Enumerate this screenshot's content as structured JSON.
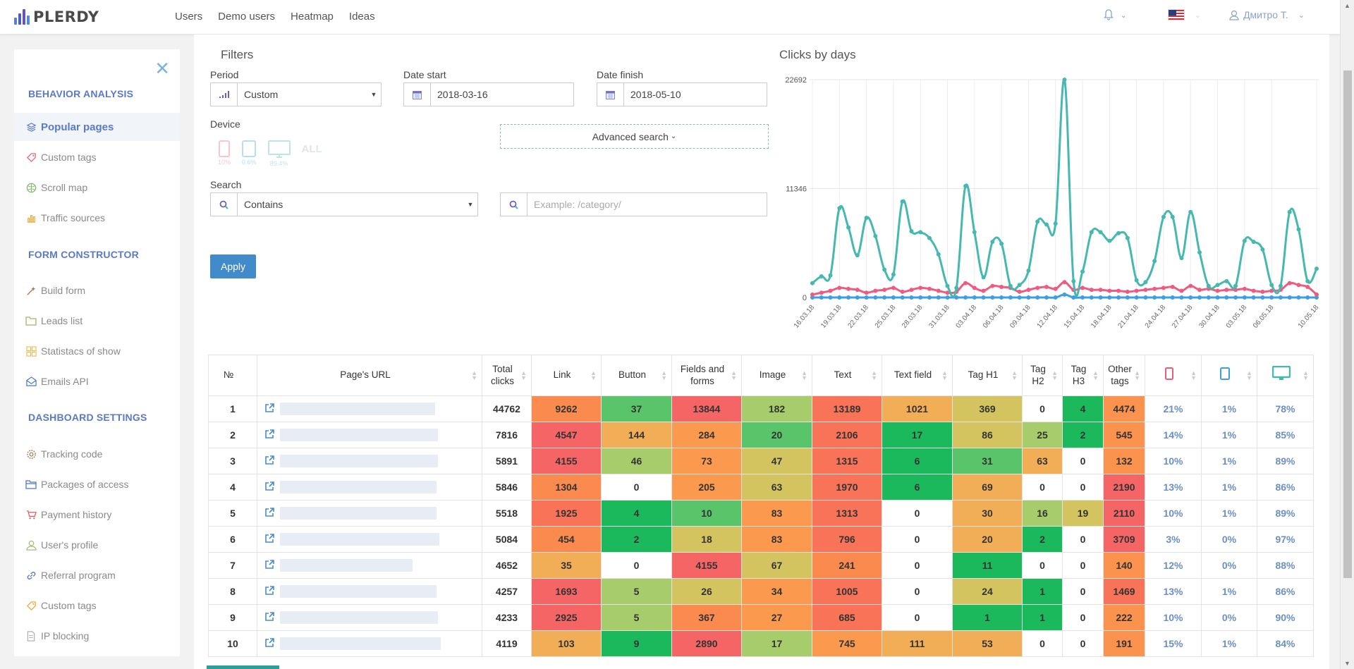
{
  "header": {
    "logo_text": "PLERDY",
    "nav": [
      "Users",
      "Demo users",
      "Heatmap",
      "Ideas"
    ],
    "user_name": "Дмитро Т.",
    "icons": {
      "notifications": "bell-icon",
      "language": "us-flag-icon",
      "user": "user-icon"
    }
  },
  "sidebar": {
    "sections": [
      {
        "heading": "BEHAVIOR ANALYSIS",
        "items": [
          {
            "label": "Popular pages",
            "icon": "layers-icon",
            "active": true
          },
          {
            "label": "Custom tags",
            "icon": "tag-icon"
          },
          {
            "label": "Scroll map",
            "icon": "scroll-icon"
          },
          {
            "label": "Traffic sources",
            "icon": "bar-chart-icon"
          }
        ]
      },
      {
        "heading": "FORM CONSTRUCTOR",
        "items": [
          {
            "label": "Build form",
            "icon": "wand-icon"
          },
          {
            "label": "Leads list",
            "icon": "folder-icon"
          },
          {
            "label": "Statistacs of show",
            "icon": "grid-icon"
          },
          {
            "label": "Emails API",
            "icon": "envelope-icon"
          }
        ]
      },
      {
        "heading": "DASHBOARD SETTINGS",
        "items": [
          {
            "label": "Tracking code",
            "icon": "gear-icon"
          },
          {
            "label": "Packages of access",
            "icon": "folder-open-icon"
          },
          {
            "label": "Payment history",
            "icon": "cart-icon"
          },
          {
            "label": "User's profile",
            "icon": "user-icon"
          },
          {
            "label": "Referral program",
            "icon": "link-icon"
          },
          {
            "label": "Custom tags",
            "icon": "tag-icon"
          },
          {
            "label": "IP blocking",
            "icon": "document-icon"
          }
        ]
      }
    ]
  },
  "filters": {
    "title": "Filters",
    "period_label": "Period",
    "period_value": "Custom",
    "date_start_label": "Date start",
    "date_start_value": "2018-03-16",
    "date_finish_label": "Date finish",
    "date_finish_value": "2018-05-10",
    "device_label": "Device",
    "devices": [
      {
        "name": "mobile",
        "pct": "10%"
      },
      {
        "name": "tablet",
        "pct": "0.6%"
      },
      {
        "name": "desktop",
        "pct": "89.4%"
      }
    ],
    "device_all": "ALL",
    "advanced_search_label": "Advanced search",
    "search_label": "Search",
    "search_mode": "Contains",
    "search_placeholder": "Example: /category/",
    "apply_label": "Apply"
  },
  "colors": {
    "accent": "#428bca",
    "heading": "#5b79c9",
    "desktop_series": "#45b8b0",
    "mobile_series": "#ef5b7e",
    "tablet_series": "#3d9fe0"
  },
  "chart_data": {
    "type": "line",
    "title": "Clicks by days",
    "xlabel": "",
    "ylabel": "",
    "ylim": [
      0,
      22692
    ],
    "yticks": [
      0,
      11346,
      22692
    ],
    "grid": true,
    "x_tick_labels": [
      "16.03.18",
      "19.03.18",
      "22.03.18",
      "25.03.18",
      "28.03.18",
      "31.03.18",
      "03.04.18",
      "06.04.18",
      "09.04.18",
      "12.04.18",
      "15.04.18",
      "18.04.18",
      "21.04.18",
      "24.04.18",
      "27.04.18",
      "30.04.18",
      "03.05.18",
      "06.05.18",
      "10.05.18"
    ],
    "series": [
      {
        "name": "Desktop",
        "values": [
          1500,
          2200,
          2300,
          9300,
          7300,
          4400,
          8300,
          6400,
          2900,
          2400,
          10000,
          6900,
          6800,
          6200,
          4500,
          1200,
          1000,
          11600,
          6800,
          2100,
          5800,
          5600,
          1200,
          1300,
          2800,
          7900,
          7600,
          7700,
          22692,
          1700,
          2700,
          6800,
          6800,
          5900,
          6700,
          6200,
          1800,
          1600,
          3800,
          8400,
          8400,
          4100,
          8900,
          4700,
          1200,
          1300,
          1700,
          1200,
          5900,
          5800,
          5000,
          1300,
          1200,
          8900,
          7100,
          1700,
          3000
        ]
      },
      {
        "name": "Mobile",
        "values": [
          300,
          500,
          700,
          1000,
          900,
          800,
          500,
          700,
          800,
          1000,
          600,
          800,
          1000,
          900,
          700,
          500,
          600,
          1500,
          1000,
          700,
          1200,
          1100,
          1000,
          600,
          800,
          1000,
          1100,
          900,
          1600,
          800,
          1000,
          800,
          800,
          700,
          700,
          600,
          700,
          800,
          900,
          1000,
          1100,
          700,
          1200,
          800,
          900,
          700,
          800,
          800,
          900,
          700,
          600,
          700,
          800,
          1500,
          1300,
          1100,
          300
        ]
      },
      {
        "name": "Tablet",
        "values": [
          0,
          0,
          0,
          0,
          0,
          0,
          0,
          0,
          0,
          0,
          0,
          0,
          0,
          0,
          0,
          0,
          0,
          0,
          0,
          0,
          0,
          0,
          0,
          0,
          0,
          0,
          0,
          0,
          300,
          0,
          0,
          0,
          0,
          0,
          0,
          0,
          0,
          0,
          0,
          0,
          0,
          0,
          0,
          0,
          0,
          0,
          0,
          0,
          0,
          0,
          0,
          0,
          0,
          0,
          0,
          0,
          0
        ]
      }
    ],
    "legend": "none"
  },
  "table": {
    "columns": [
      "№",
      "Page's URL",
      "Total clicks",
      "Link",
      "Button",
      "Fields and forms",
      "Image",
      "Text",
      "Text field",
      "Tag H1",
      "Tag H2",
      "Tag H3",
      "Other tags",
      "mobile-icon",
      "tablet-icon",
      "desktop-icon"
    ],
    "rows": [
      {
        "n": "1",
        "total": "44762",
        "cells": [
          "9262",
          "37",
          "13844",
          "182",
          "13189",
          "1021",
          "369",
          "0",
          "4",
          "4474"
        ],
        "colors": [
          "#fb8a4f",
          "#5ac46b",
          "#f56565",
          "#a7cc6b",
          "#f87358",
          "#f2ae57",
          "#d4c45f",
          "#ffffff",
          "#1cb85c",
          "#fb924e"
        ],
        "mobile": "21%",
        "tablet": "1%",
        "desktop": "78%"
      },
      {
        "n": "2",
        "total": "7816",
        "cells": [
          "4547",
          "144",
          "284",
          "20",
          "2106",
          "17",
          "86",
          "25",
          "2",
          "545"
        ],
        "colors": [
          "#f56565",
          "#f2ae57",
          "#fb9a4e",
          "#5ac46b",
          "#f87358",
          "#1cb85c",
          "#d4c45f",
          "#a7cc6b",
          "#1cb85c",
          "#fb924e"
        ],
        "mobile": "14%",
        "tablet": "1%",
        "desktop": "85%"
      },
      {
        "n": "3",
        "total": "5891",
        "cells": [
          "4155",
          "46",
          "73",
          "47",
          "1315",
          "6",
          "31",
          "63",
          "0",
          "132"
        ],
        "colors": [
          "#f56565",
          "#a7cc6b",
          "#fb9a4e",
          "#d4c45f",
          "#f87358",
          "#1cb85c",
          "#5ac46b",
          "#f2ae57",
          "#ffffff",
          "#fb924e"
        ],
        "mobile": "10%",
        "tablet": "1%",
        "desktop": "89%"
      },
      {
        "n": "4",
        "total": "5846",
        "cells": [
          "1304",
          "0",
          "205",
          "63",
          "1970",
          "6",
          "69",
          "0",
          "0",
          "2190"
        ],
        "colors": [
          "#fb8a4f",
          "#ffffff",
          "#fb9a4e",
          "#d4c45f",
          "#f87358",
          "#1cb85c",
          "#f2ae57",
          "#ffffff",
          "#ffffff",
          "#f56565"
        ],
        "mobile": "13%",
        "tablet": "1%",
        "desktop": "86%"
      },
      {
        "n": "5",
        "total": "5518",
        "cells": [
          "1925",
          "4",
          "10",
          "83",
          "1313",
          "0",
          "30",
          "16",
          "19",
          "2110"
        ],
        "colors": [
          "#f87358",
          "#1cb85c",
          "#5ac46b",
          "#fb9a4e",
          "#f87358",
          "#ffffff",
          "#f2ae57",
          "#a7cc6b",
          "#d4c45f",
          "#f56565"
        ],
        "mobile": "10%",
        "tablet": "1%",
        "desktop": "89%"
      },
      {
        "n": "6",
        "total": "5084",
        "cells": [
          "454",
          "2",
          "18",
          "83",
          "796",
          "0",
          "20",
          "2",
          "0",
          "3709"
        ],
        "colors": [
          "#fb8a4f",
          "#1cb85c",
          "#d4c45f",
          "#fb9a4e",
          "#f87358",
          "#ffffff",
          "#f2ae57",
          "#1cb85c",
          "#ffffff",
          "#f56565"
        ],
        "mobile": "3%",
        "tablet": "0%",
        "desktop": "97%"
      },
      {
        "n": "7",
        "total": "4652",
        "cells": [
          "35",
          "0",
          "4155",
          "67",
          "241",
          "0",
          "11",
          "0",
          "0",
          "140"
        ],
        "colors": [
          "#f2ae57",
          "#ffffff",
          "#f56565",
          "#d4c45f",
          "#fb8a4f",
          "#ffffff",
          "#1cb85c",
          "#ffffff",
          "#ffffff",
          "#fb924e"
        ],
        "mobile": "12%",
        "tablet": "0%",
        "desktop": "88%"
      },
      {
        "n": "8",
        "total": "4257",
        "cells": [
          "1693",
          "5",
          "26",
          "34",
          "1005",
          "0",
          "24",
          "1",
          "0",
          "1469"
        ],
        "colors": [
          "#f56565",
          "#a7cc6b",
          "#d4c45f",
          "#fb9a4e",
          "#f87358",
          "#ffffff",
          "#d4c45f",
          "#1cb85c",
          "#ffffff",
          "#f87358"
        ],
        "mobile": "13%",
        "tablet": "1%",
        "desktop": "86%"
      },
      {
        "n": "9",
        "total": "4233",
        "cells": [
          "2925",
          "5",
          "367",
          "27",
          "685",
          "0",
          "1",
          "1",
          "0",
          "222"
        ],
        "colors": [
          "#f56565",
          "#a7cc6b",
          "#fb8a4f",
          "#fb9a4e",
          "#f87358",
          "#ffffff",
          "#1cb85c",
          "#1cb85c",
          "#ffffff",
          "#fb924e"
        ],
        "mobile": "10%",
        "tablet": "0%",
        "desktop": "90%"
      },
      {
        "n": "10",
        "total": "4119",
        "cells": [
          "103",
          "9",
          "2890",
          "17",
          "745",
          "111",
          "53",
          "0",
          "0",
          "191"
        ],
        "colors": [
          "#f2ae57",
          "#1cb85c",
          "#f56565",
          "#a7cc6b",
          "#fb9a4e",
          "#f2ae57",
          "#f2ae57",
          "#ffffff",
          "#ffffff",
          "#fb924e"
        ],
        "mobile": "15%",
        "tablet": "1%",
        "desktop": "84%"
      }
    ]
  }
}
